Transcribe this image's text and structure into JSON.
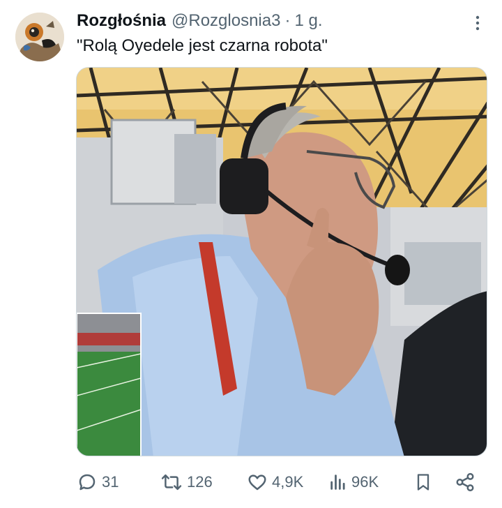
{
  "tweet": {
    "author_name": "Rozgłośnia",
    "author_handle": "@Rozglosnia3",
    "separator": "·",
    "time": "1 g.",
    "text": "\"Rolą Oyedele jest czarna robota\"",
    "icons": {
      "more": "more-vertical-icon",
      "reply": "reply-bubble-icon",
      "retweet": "retweet-arrows-icon",
      "like": "heart-icon",
      "views": "views-bars-icon",
      "bookmark": "bookmark-icon",
      "share": "share-icon"
    },
    "stats": {
      "replies": "31",
      "retweets": "126",
      "likes": "4,9K",
      "views": "96K"
    },
    "colors": {
      "text_primary": "#0f1419",
      "text_secondary": "#536471"
    }
  }
}
